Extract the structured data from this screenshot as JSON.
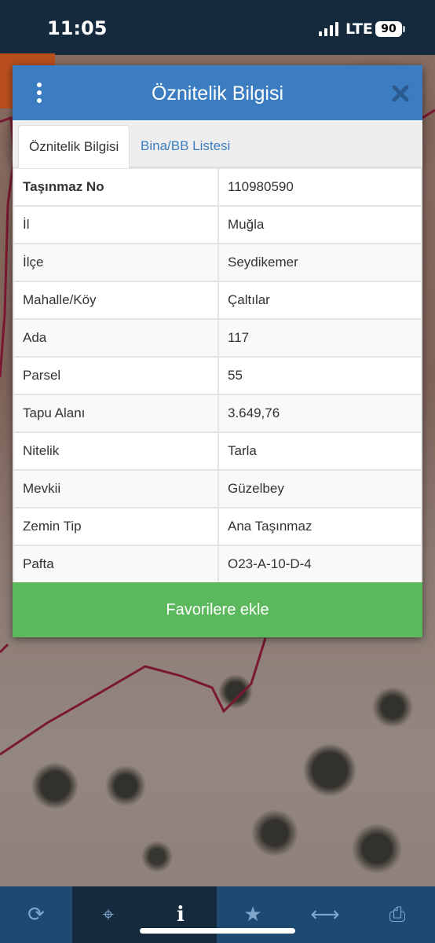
{
  "status_bar": {
    "time": "11:05",
    "network": "LTE",
    "battery": "90"
  },
  "modal": {
    "title": "Öznitelik Bilgisi",
    "menu_icon": "vertical-dots-icon",
    "close_icon": "close-icon",
    "tabs": [
      {
        "label": "Öznitelik Bilgisi",
        "active": true
      },
      {
        "label": "Bina/BB Listesi",
        "active": false
      }
    ],
    "rows": [
      {
        "key": "Taşınmaz No",
        "value": "110980590"
      },
      {
        "key": "İl",
        "value": "Muğla"
      },
      {
        "key": "İlçe",
        "value": "Seydikemer"
      },
      {
        "key": "Mahalle/Köy",
        "value": "Çaltılar"
      },
      {
        "key": "Ada",
        "value": "117"
      },
      {
        "key": "Parsel",
        "value": "55"
      },
      {
        "key": "Tapu Alanı",
        "value": "3.649,76"
      },
      {
        "key": "Nitelik",
        "value": "Tarla"
      },
      {
        "key": "Mevkii",
        "value": "Güzelbey"
      },
      {
        "key": "Zemin Tip",
        "value": "Ana Taşınmaz"
      },
      {
        "key": "Pafta",
        "value": "O23-A-10-D-4"
      }
    ],
    "favorite_button": "Favorilere ekle"
  },
  "toolbar": {
    "items": [
      {
        "icon": "refresh-icon",
        "glyph": "⟳"
      },
      {
        "icon": "crosshair-icon",
        "glyph": "⌖"
      },
      {
        "icon": "info-icon",
        "glyph": "i"
      },
      {
        "icon": "star-icon",
        "glyph": "★"
      },
      {
        "icon": "measure-arrows-icon",
        "glyph": "⟷"
      },
      {
        "icon": "print-icon",
        "glyph": "⎙"
      }
    ]
  },
  "colors": {
    "header": "#3b7dc0",
    "button": "#5cb85c",
    "toolbar": "#1e4a72",
    "toolbar_active": "#152a3d",
    "parcel_border": "#7a1830"
  }
}
